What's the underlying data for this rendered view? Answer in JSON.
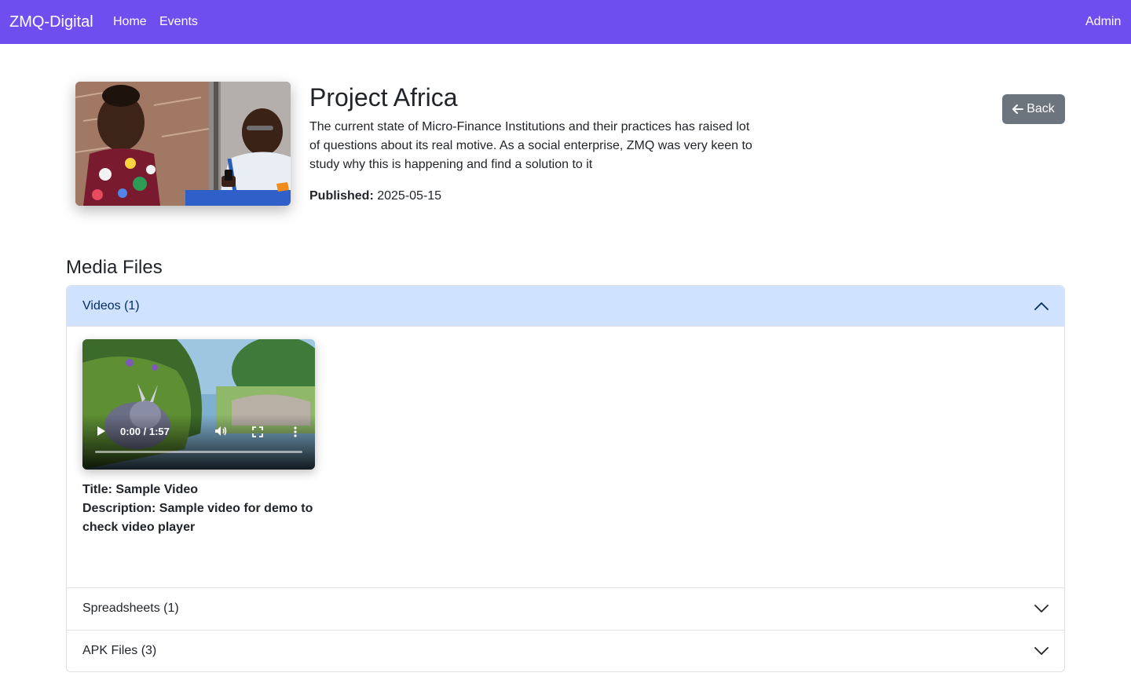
{
  "navbar": {
    "brand": "ZMQ-Digital",
    "links": [
      "Home",
      "Events"
    ],
    "user": "Admin"
  },
  "project": {
    "title": "Project Africa",
    "description": "The current state of Micro-Finance Institutions and their practices has raised lot of questions about its real motive. As a social enterprise, ZMQ was very keen to study why this is happening and find a solution to it",
    "published_label": "Published:",
    "published_date": "2025-05-15"
  },
  "back_button": {
    "label": "Back",
    "icon": "arrow-left-icon"
  },
  "media": {
    "heading": "Media Files",
    "sections": [
      {
        "label": "Videos (1)",
        "expanded": true
      },
      {
        "label": "Spreadsheets (1)",
        "expanded": false
      },
      {
        "label": "APK Files (3)",
        "expanded": false
      }
    ],
    "video": {
      "time": "0:00 / 1:57",
      "title_label": "Title:",
      "title": "Sample Video",
      "description_label": "Description:",
      "description": "Sample video for demo to check video player"
    }
  },
  "colors": {
    "navbar": "#6f4ef0",
    "accordion_active": "#cfe2ff",
    "back_button": "#6c757d"
  }
}
